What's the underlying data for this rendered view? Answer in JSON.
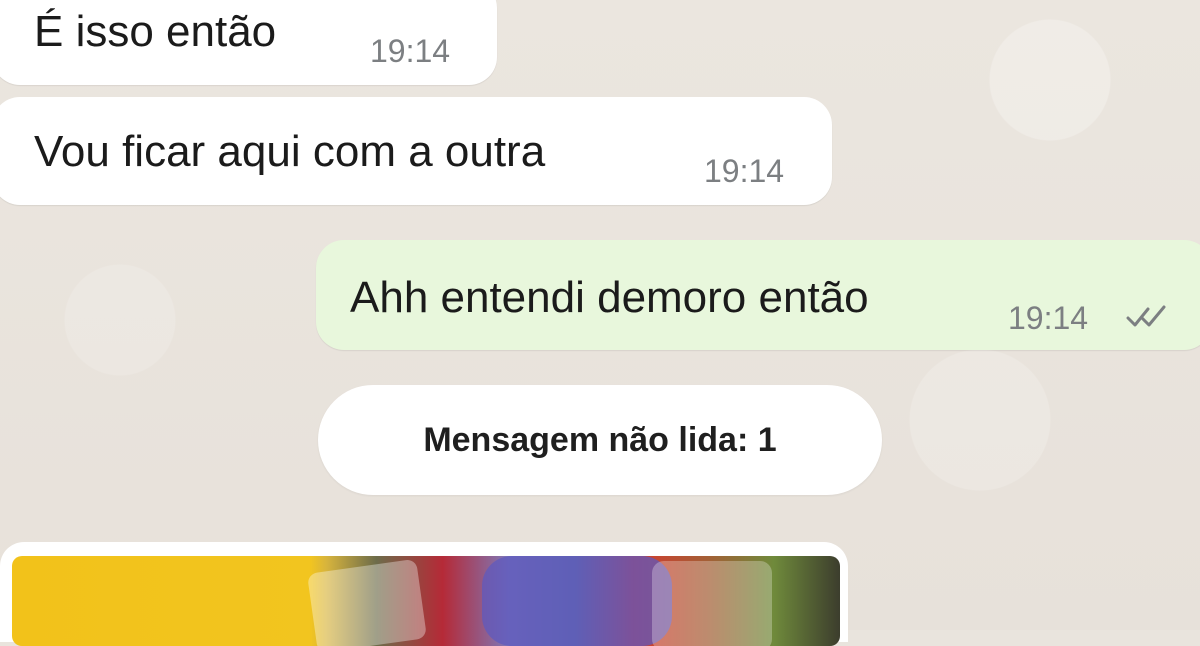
{
  "chat": {
    "messages": [
      {
        "direction": "incoming",
        "text": "É isso então",
        "time": "19:14"
      },
      {
        "direction": "incoming",
        "text": "Vou ficar aqui com a outra",
        "time": "19:14"
      },
      {
        "direction": "outgoing",
        "text": "Ahh entendi demoro então",
        "time": "19:14",
        "status_icon": "double-check-icon"
      }
    ],
    "unread_banner": "Mensagem não lida: 1",
    "media_message": {
      "type": "image"
    }
  },
  "colors": {
    "background": "#e9e4dd",
    "incoming_bubble": "#ffffff",
    "outgoing_bubble": "#e8f7dc",
    "timestamp": "#7c7f82",
    "text": "#1b1b1b"
  }
}
